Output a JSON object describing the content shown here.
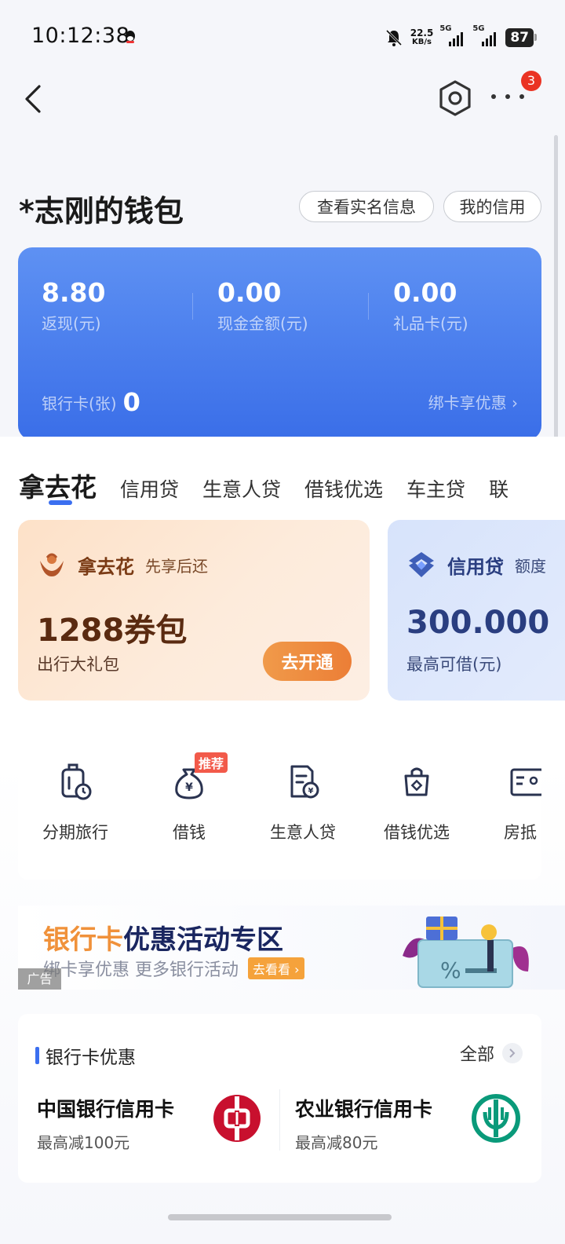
{
  "status_bar": {
    "time": "10:12:38",
    "speed_value": "22.5",
    "speed_unit": "KB/s",
    "network1": "5G",
    "network2": "5G",
    "battery": "87"
  },
  "nav": {
    "notification_count": "3"
  },
  "wallet": {
    "title": "*志刚的钱包",
    "realname_btn": "查看实名信息",
    "credit_btn": "我的信用"
  },
  "summary": {
    "items": [
      {
        "value": "8.80",
        "label": "返现(元)"
      },
      {
        "value": "0.00",
        "label": "现金金额(元)"
      },
      {
        "value": "0.00",
        "label": "礼品卡(元)"
      }
    ],
    "bank_label": "银行卡(张)",
    "bank_count": "0",
    "bind_text": "绑卡享优惠"
  },
  "tabs": [
    "拿去花",
    "信用贷",
    "生意人贷",
    "借钱优选",
    "车主贷",
    "联"
  ],
  "products": {
    "naquhua": {
      "name": "拿去花",
      "tagline": "先享后还",
      "big": "1288券包",
      "desc": "出行大礼包",
      "button": "去开通"
    },
    "xinyongdai": {
      "name": "信用贷",
      "tagline": "额度",
      "big": "300.000",
      "desc": "最高可借(元)"
    }
  },
  "services": {
    "items": [
      {
        "label": "分期旅行",
        "icon": "luggage-icon"
      },
      {
        "label": "借钱",
        "icon": "money-bag-icon"
      },
      {
        "label": "生意人贷",
        "icon": "document-coin-icon"
      },
      {
        "label": "借钱优选",
        "icon": "shopping-bag-icon"
      },
      {
        "label": "房抵",
        "icon": "id-card-icon"
      }
    ],
    "recommend_badge": "推荐"
  },
  "banner": {
    "title_accent": "银行卡",
    "title_rest": "优惠活动专区",
    "subtitle": "绑卡享优惠 更多银行活动",
    "button": "去看看",
    "ad_tag": "广告"
  },
  "bank_offers": {
    "title": "银行卡优惠",
    "all": "全部",
    "items": [
      {
        "name": "中国银行信用卡",
        "offer": "最高减100元",
        "icon": "boc-logo-icon"
      },
      {
        "name": "农业银行信用卡",
        "offer": "最高减80元",
        "icon": "abc-logo-icon"
      }
    ]
  },
  "colors": {
    "accent_blue": "#3b6ff0",
    "orange": "#ec7e36",
    "badge_red": "#ea3323",
    "boc_red": "#c8102e",
    "abc_green": "#0a9a7a"
  }
}
